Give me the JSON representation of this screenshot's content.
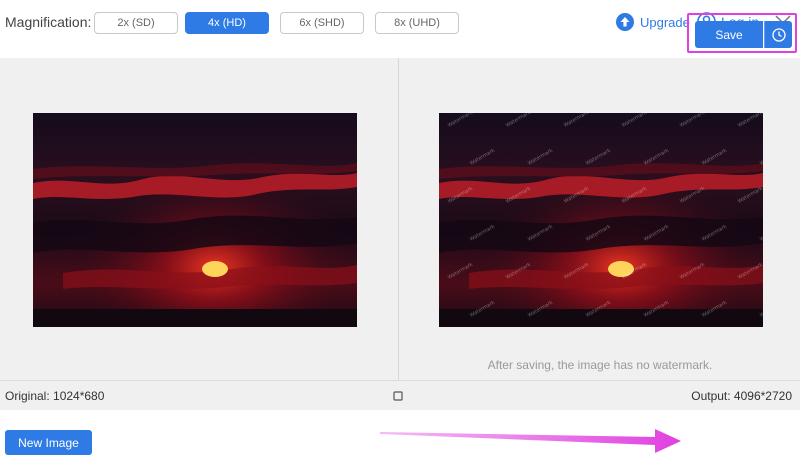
{
  "toolbar": {
    "magnification_label": "Magnification:",
    "options": [
      {
        "label": "2x (SD)",
        "selected": false
      },
      {
        "label": "4x (HD)",
        "selected": true
      },
      {
        "label": "6x (SHD)",
        "selected": false
      },
      {
        "label": "8x (UHD)",
        "selected": false
      }
    ],
    "upgrade_label": "Upgrade",
    "login_label": "Log in"
  },
  "preview": {
    "watermark_note": "After saving, the image has no watermark.",
    "watermark_text": "Watermark"
  },
  "info": {
    "original": "Original: 1024*680",
    "output": "Output: 4096*2720"
  },
  "actions": {
    "new_image_label": "New Image",
    "save_label": "Save"
  },
  "colors": {
    "accent": "#2f7be5",
    "annotation": "#e040e0"
  },
  "icons": {
    "upgrade": "arrow-up-circle-icon",
    "login": "user-circle-icon",
    "close": "close-icon",
    "compare": "square-icon",
    "history": "clock-icon"
  }
}
